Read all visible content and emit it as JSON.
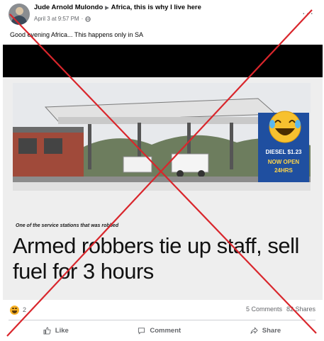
{
  "post": {
    "author": "Jude Arnold Mulondo",
    "group": "Africa, this is why I live here",
    "timestamp": "April 3 at 9:57 PM",
    "caption": "Good evening Africa... This happens only in SA",
    "more_label": "···"
  },
  "image": {
    "headline": "Armed robbers tie up staff, sell fuel for 3 hours",
    "photo_caption": "One of the service stations that was robbed",
    "price_sign": [
      "DIESEL $1.23",
      "NOW OPEN",
      "24HRS"
    ]
  },
  "engagement": {
    "reaction_count": "2",
    "comments": "5 Comments",
    "shares": "82 Shares"
  },
  "actions": {
    "like": "Like",
    "comment": "Comment",
    "share": "Share"
  },
  "colors": {
    "overlay_x": "#d9262c",
    "accent_text": "#65676b"
  },
  "icons": {
    "reaction": "laughing-emoji-icon",
    "privacy": "globe-icon",
    "like": "thumbs-up-icon",
    "comment": "speech-bubble-icon",
    "share": "share-arrow-icon"
  }
}
